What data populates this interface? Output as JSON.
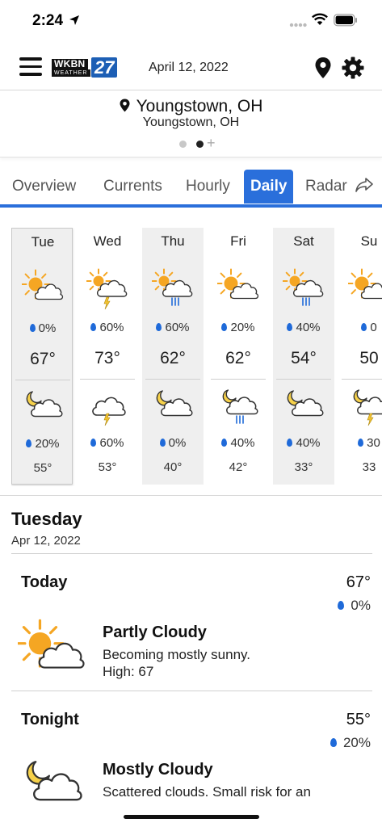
{
  "status_bar": {
    "time": "2:24"
  },
  "header": {
    "logo_text": "WKBN",
    "logo_sub": "WEATHER",
    "logo_number": "27",
    "date": "April 12, 2022"
  },
  "location": {
    "title": "Youngstown, OH",
    "subtitle": "Youngstown, OH"
  },
  "tabs": [
    {
      "label": "Overview"
    },
    {
      "label": "Currents"
    },
    {
      "label": "Hourly"
    },
    {
      "label": "Daily"
    },
    {
      "label": "Radar"
    }
  ],
  "active_tab": "Daily",
  "days": [
    {
      "name": "Tue",
      "day_icon": "partly-sunny-icon",
      "day_precip": "0%",
      "high": "67°",
      "night_icon": "moon-cloud-icon",
      "night_precip": "20%",
      "low": "55°"
    },
    {
      "name": "Wed",
      "day_icon": "sun-thunderstorm-icon",
      "day_precip": "60%",
      "high": "73°",
      "night_icon": "thunderstorm-icon",
      "night_precip": "60%",
      "low": "53°"
    },
    {
      "name": "Thu",
      "day_icon": "sun-rain-icon",
      "day_precip": "60%",
      "high": "62°",
      "night_icon": "moon-cloud-icon",
      "night_precip": "0%",
      "low": "40°"
    },
    {
      "name": "Fri",
      "day_icon": "partly-sunny-icon",
      "day_precip": "20%",
      "high": "62°",
      "night_icon": "moon-rain-icon",
      "night_precip": "40%",
      "low": "42°"
    },
    {
      "name": "Sat",
      "day_icon": "sun-rain-icon",
      "day_precip": "40%",
      "high": "54°",
      "night_icon": "moon-cloud-icon",
      "night_precip": "40%",
      "low": "33°"
    },
    {
      "name": "Su",
      "day_icon": "partly-sunny-icon",
      "day_precip": "0",
      "high": "50",
      "night_icon": "moon-thunderstorm-icon",
      "night_precip": "30",
      "low": "33"
    }
  ],
  "detail": {
    "title": "Tuesday",
    "date": "Apr 12, 2022",
    "periods": [
      {
        "name": "Today",
        "temp": "67°",
        "precip": "0%",
        "icon": "partly-sunny-icon",
        "condition": "Partly Cloudy",
        "desc_line1": "Becoming mostly sunny.",
        "desc_line2": "High: 67"
      },
      {
        "name": "Tonight",
        "temp": "55°",
        "precip": "20%",
        "icon": "moon-cloud-icon",
        "condition": "Mostly Cloudy",
        "desc_line1": "Scattered clouds.  Small risk for an",
        "desc_line2": ""
      }
    ]
  },
  "colors": {
    "accent": "#2a6fdb",
    "sun": "#f5a623",
    "moon": "#f6d14a",
    "rain": "#1f6ad9",
    "bolt": "#f2c230"
  }
}
